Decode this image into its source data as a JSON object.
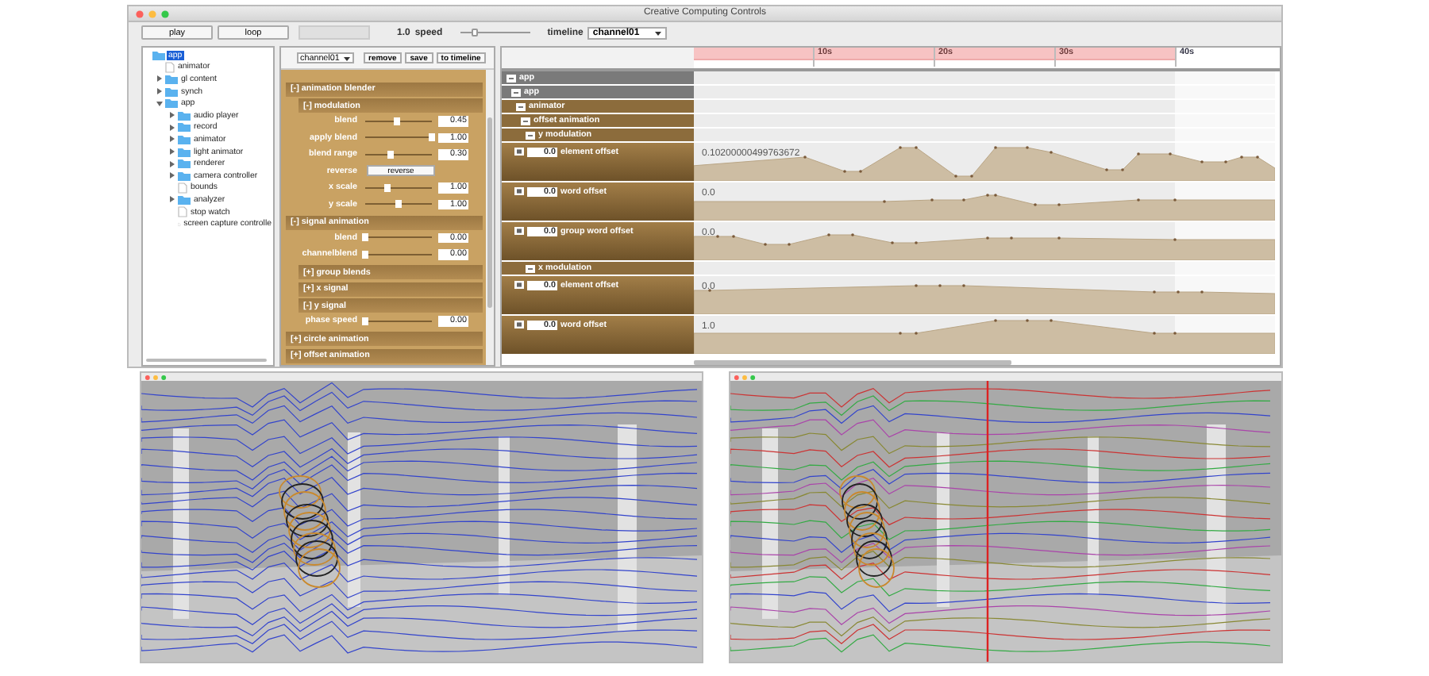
{
  "window": {
    "title": "Creative Computing Controls"
  },
  "toolbar": {
    "buttons": [
      "play",
      "loop"
    ],
    "speed": {
      "value": "1.0",
      "label": "speed",
      "level": 0.22
    },
    "timeline_select": {
      "label": "timeline",
      "value": "channel01"
    }
  },
  "tree": {
    "items": [
      {
        "label": "app",
        "kind": "folder",
        "selected": true,
        "children": [
          {
            "label": "animator",
            "kind": "file",
            "selected": false
          },
          {
            "label": "gl content",
            "kind": "folder",
            "expanded": false,
            "selected": false
          },
          {
            "label": "synch",
            "kind": "folder",
            "expanded": false,
            "selected": false
          },
          {
            "label": "app",
            "kind": "folder",
            "expanded": true,
            "selected": false,
            "children": [
              {
                "label": "audio player",
                "kind": "folder",
                "expanded": false,
                "selected": false
              },
              {
                "label": "record",
                "kind": "folder",
                "expanded": false,
                "selected": false
              },
              {
                "label": "animator",
                "kind": "folder",
                "expanded": false,
                "selected": false
              },
              {
                "label": "light animator",
                "kind": "folder",
                "expanded": false,
                "selected": false
              },
              {
                "label": "renderer",
                "kind": "folder",
                "expanded": false,
                "selected": false
              },
              {
                "label": "camera controller",
                "kind": "folder",
                "expanded": false,
                "selected": false
              },
              {
                "label": "bounds",
                "kind": "file",
                "selected": false
              },
              {
                "label": "analyzer",
                "kind": "folder",
                "expanded": false,
                "selected": false
              },
              {
                "label": "stop watch",
                "kind": "file",
                "selected": false
              },
              {
                "label": "screen capture controlle",
                "kind": "file",
                "selected": false
              }
            ]
          }
        ]
      }
    ]
  },
  "params": {
    "channel": "channel01",
    "buttons": [
      "remove",
      "save",
      "to timeline"
    ],
    "items": [
      {
        "kind": "section",
        "label": "[-] animation blender",
        "children": [
          {
            "kind": "section",
            "label": "[-] modulation",
            "children": [
              {
                "kind": "slider",
                "label": "blend",
                "level": 0.48,
                "value": "0.45"
              },
              {
                "kind": "slider",
                "label": "apply blend",
                "level": 1.0,
                "value": "1.00"
              },
              {
                "kind": "slider",
                "label": "blend range",
                "level": 0.38,
                "value": "0.30"
              },
              {
                "kind": "button",
                "label": "reverse",
                "button": "reverse"
              },
              {
                "kind": "slider",
                "label": "x scale",
                "level": 0.33,
                "value": "1.00"
              },
              {
                "kind": "slider",
                "label": "y scale",
                "level": 0.5,
                "value": "1.00"
              }
            ]
          }
        ]
      },
      {
        "kind": "section",
        "label": "[-] signal animation",
        "children": [
          {
            "kind": "slider",
            "label": "blend",
            "level": 0.0,
            "value": "0.00"
          },
          {
            "kind": "slider",
            "label": "channelblend",
            "level": 0.0,
            "value": "0.00"
          },
          {
            "kind": "section",
            "label": "[+] group blends"
          },
          {
            "kind": "section",
            "label": "[+] x signal"
          },
          {
            "kind": "section",
            "label": "[-] y signal",
            "children": [
              {
                "kind": "slider",
                "label": "phase speed",
                "level": 0.0,
                "value": "0.00"
              }
            ]
          }
        ]
      },
      {
        "kind": "section",
        "label": "[+] circle animation"
      },
      {
        "kind": "section",
        "label": "[+] offset animation"
      }
    ]
  },
  "timeline": {
    "ruler": [
      "10s",
      "20s",
      "30s",
      "40s"
    ],
    "tracks": [
      {
        "kind": "group",
        "label": "app",
        "children": [
          {
            "kind": "group",
            "label": "app",
            "children": [
              {
                "kind": "group",
                "label": "animator",
                "children": [
                  {
                    "kind": "group",
                    "label": "offset animation",
                    "children": [
                      {
                        "kind": "group",
                        "label": "y modulation",
                        "children": [
                          {
                            "kind": "curve",
                            "label": "element offset",
                            "value": "0.0",
                            "readout": "0.10200000499763672"
                          },
                          {
                            "kind": "curve",
                            "label": "word offset",
                            "value": "0.0",
                            "readout": "0.0"
                          },
                          {
                            "kind": "curve",
                            "label": "group word offset",
                            "value": "0.0",
                            "readout": "0.0"
                          }
                        ]
                      },
                      {
                        "kind": "group",
                        "label": "x modulation",
                        "children": [
                          {
                            "kind": "curve",
                            "label": "element offset",
                            "value": "0.0",
                            "readout": "0.0"
                          },
                          {
                            "kind": "curve",
                            "label": "word offset",
                            "value": "0.0",
                            "readout": "1.0"
                          }
                        ]
                      }
                    ]
                  }
                ]
              }
            ]
          }
        ]
      }
    ]
  },
  "viewports": [
    {
      "kind": "mono"
    },
    {
      "kind": "color"
    }
  ]
}
